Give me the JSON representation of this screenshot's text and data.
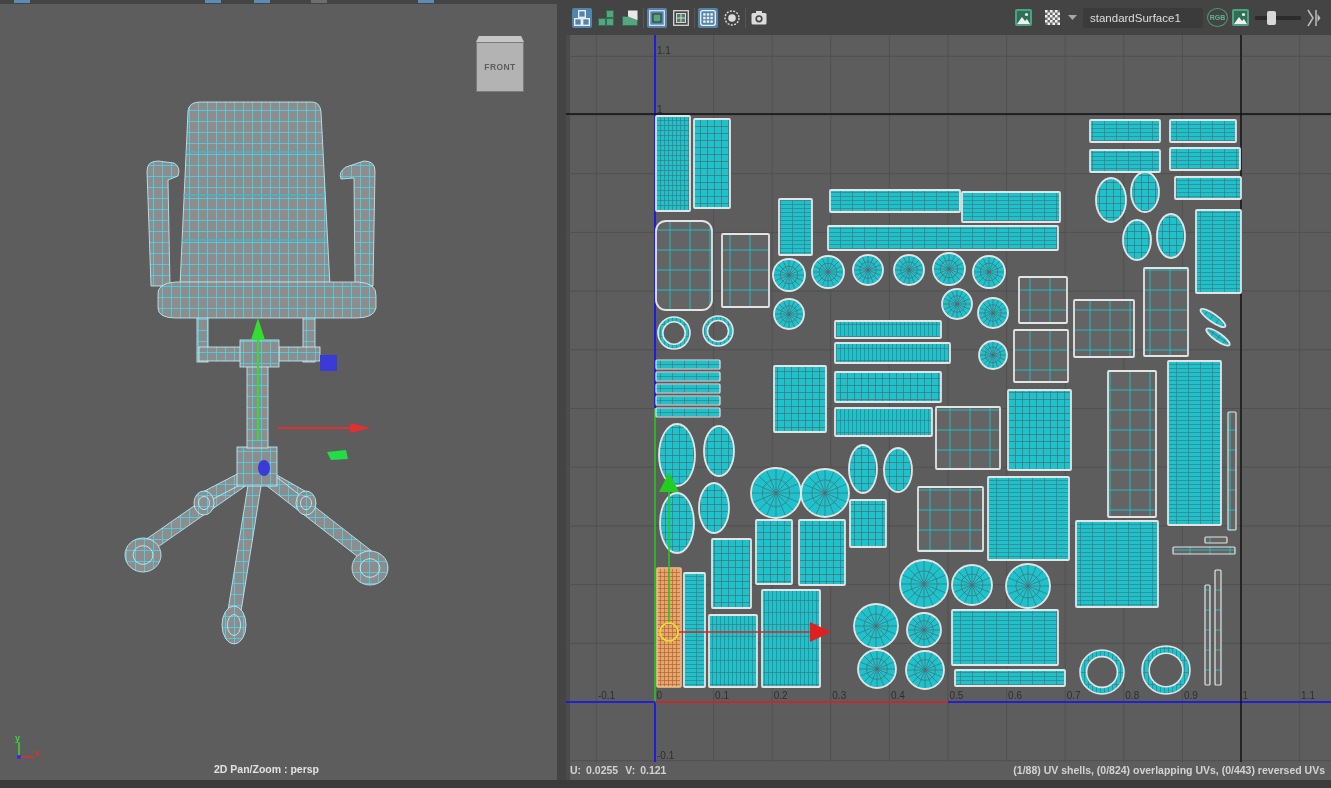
{
  "viewport": {
    "toolbar": [
      {
        "selected": true
      },
      {
        "selected": true
      },
      {
        "selected": true
      },
      {
        "selected": false
      },
      {
        "selected": true
      }
    ],
    "view_cube": {
      "label": "FRONT"
    },
    "axis_indicator": {
      "y_label": "y",
      "x_label": "x"
    },
    "camera_label": "2D Pan/Zoom : persp"
  },
  "uv_editor": {
    "toolbar": {
      "tool_groups": [
        [
          {
            "selected": true
          },
          {
            "selected": false
          },
          {
            "selected": false
          }
        ],
        [
          {
            "selected": true
          },
          {
            "selected": false
          }
        ],
        [
          {
            "selected": true
          },
          {
            "selected": false
          }
        ],
        [
          {
            "selected": false
          }
        ]
      ],
      "shader_field": {
        "value": "standardSurface1"
      },
      "rgb_button": {
        "label": "RGB"
      },
      "slider": {
        "level": 0.32
      }
    },
    "grid": {
      "u_ticks": [
        "-0.1",
        "0",
        "0.1",
        "0.2",
        "0.3",
        "0.4",
        "0.5",
        "0.6",
        "0.7",
        "0.8",
        "0.9",
        "1",
        "1.1"
      ],
      "v_ticks": [
        "1.1",
        "1",
        "-0.1"
      ]
    },
    "selection": {
      "shell_selected": true
    },
    "status": {
      "coordinates": [
        {
          "label": "U:",
          "value": "0.0255"
        },
        {
          "label": "V:",
          "value": "0.121"
        }
      ],
      "summary": "(1/88) UV shells, (0/824) overlapping UVs, (0/443) reversed UVs"
    }
  }
}
